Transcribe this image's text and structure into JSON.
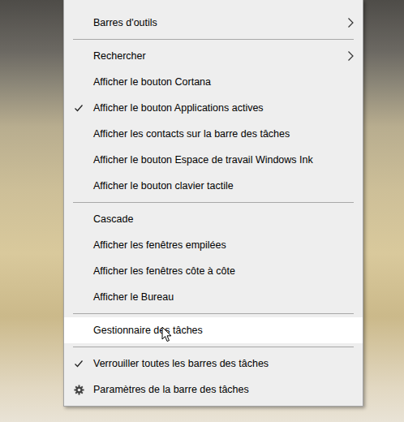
{
  "menu": {
    "items": [
      {
        "kind": "item",
        "label": "Barres d'outils",
        "checked": false,
        "submenu": true,
        "selected": false
      },
      {
        "kind": "separator"
      },
      {
        "kind": "item",
        "label": "Rechercher",
        "checked": false,
        "submenu": true,
        "selected": false
      },
      {
        "kind": "item",
        "label": "Afficher le bouton Cortana",
        "checked": false,
        "submenu": false,
        "selected": false
      },
      {
        "kind": "item",
        "label": "Afficher le bouton Applications actives",
        "checked": true,
        "submenu": false,
        "selected": false
      },
      {
        "kind": "item",
        "label": "Afficher les contacts sur la barre des tâches",
        "checked": false,
        "submenu": false,
        "selected": false
      },
      {
        "kind": "item",
        "label": "Afficher le bouton Espace de travail Windows Ink",
        "checked": false,
        "submenu": false,
        "selected": false
      },
      {
        "kind": "item",
        "label": "Afficher le bouton clavier tactile",
        "checked": false,
        "submenu": false,
        "selected": false
      },
      {
        "kind": "separator"
      },
      {
        "kind": "item",
        "label": "Cascade",
        "checked": false,
        "submenu": false,
        "selected": false
      },
      {
        "kind": "item",
        "label": "Afficher les fenêtres empilées",
        "checked": false,
        "submenu": false,
        "selected": false
      },
      {
        "kind": "item",
        "label": "Afficher les fenêtres côte à côte",
        "checked": false,
        "submenu": false,
        "selected": false
      },
      {
        "kind": "item",
        "label": "Afficher le Bureau",
        "checked": false,
        "submenu": false,
        "selected": false
      },
      {
        "kind": "separator"
      },
      {
        "kind": "item",
        "label": "Gestionnaire des tâches",
        "checked": false,
        "submenu": false,
        "selected": true
      },
      {
        "kind": "separator"
      },
      {
        "kind": "item",
        "label": "Verrouiller toutes les barres des tâches",
        "checked": true,
        "submenu": false,
        "selected": false
      },
      {
        "kind": "settings",
        "label": "Paramètres de la barre des tâches",
        "checked": false,
        "submenu": false,
        "selected": false
      }
    ]
  }
}
